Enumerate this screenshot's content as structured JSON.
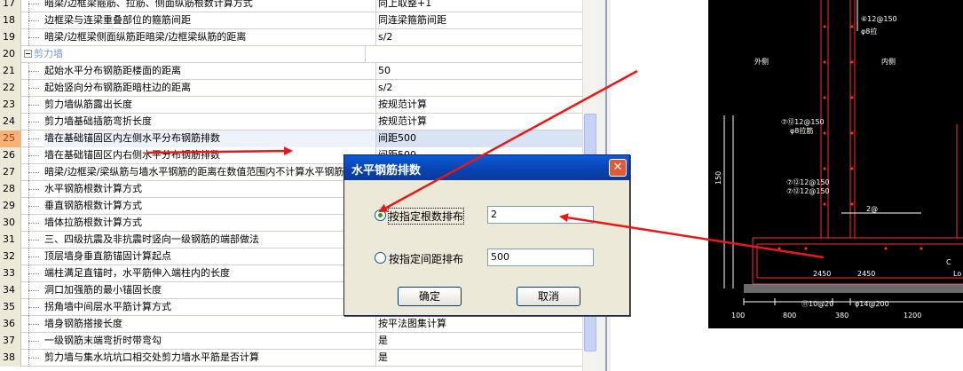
{
  "table": {
    "rows": [
      {
        "num": "17",
        "name": "暗梁/边框梁箍筋、拉筋、侧面纵筋根数计算方式",
        "value": "向上取整+1"
      },
      {
        "num": "18",
        "name": "边框梁与连梁重叠部位的箍筋间距",
        "value": "同连梁箍筋间距"
      },
      {
        "num": "19",
        "name": "暗梁/边框梁侧面纵筋距暗梁/边框梁纵筋的距离",
        "value": "s/2"
      },
      {
        "num": "20",
        "name": "剪力墙",
        "value": "",
        "category": true
      },
      {
        "num": "21",
        "name": "起始水平分布钢筋距楼面的距离",
        "value": "50"
      },
      {
        "num": "22",
        "name": "起始竖向分布钢筋距暗柱边的距离",
        "value": "s/2"
      },
      {
        "num": "23",
        "name": "剪力墙纵筋露出长度",
        "value": "按规范计算"
      },
      {
        "num": "24",
        "name": "剪力墙基础插筋弯折长度",
        "value": "按规范计算"
      },
      {
        "num": "25",
        "name": "墙在基础锚固区内左侧水平分布钢筋排数",
        "value": "间距500",
        "selected": true
      },
      {
        "num": "26",
        "name": "墙在基础锚固区内右侧水平分布钢筋排数",
        "value": "间距500"
      },
      {
        "num": "27",
        "name": "暗梁/边框梁/梁纵筋与墙水平钢筋的距离在数值范围内不计算水平钢筋",
        "value": ""
      },
      {
        "num": "28",
        "name": "水平钢筋根数计算方式",
        "value": ""
      },
      {
        "num": "29",
        "name": "垂直钢筋根数计算方式",
        "value": ""
      },
      {
        "num": "30",
        "name": "墙体拉筋根数计算方式",
        "value": ""
      },
      {
        "num": "31",
        "name": "三、四级抗震及非抗震时竖向一级钢筋的端部做法",
        "value": ""
      },
      {
        "num": "32",
        "name": "顶层墙身垂直筋锚固计算起点",
        "value": ""
      },
      {
        "num": "33",
        "name": "端柱满足直锚时，水平筋伸入端柱内的长度",
        "value": ""
      },
      {
        "num": "34",
        "name": "洞口加强筋的最小锚固长度",
        "value": ""
      },
      {
        "num": "35",
        "name": "拐角墙中间层水平筋计算方式",
        "value": ""
      },
      {
        "num": "36",
        "name": "墙身钢筋搭接长度",
        "value": "按平法图集计算"
      },
      {
        "num": "37",
        "name": "一级钢筋末端弯折时带弯勾",
        "value": "是"
      },
      {
        "num": "38",
        "name": "剪力墙与集水坑坑口相交处剪力墙水平筋是否计算",
        "value": "是"
      }
    ]
  },
  "dialog": {
    "title": "水平钢筋排数",
    "close_glyph": "✕",
    "option1_label": "按指定根数排布",
    "option1_value": "2",
    "option2_label": "按指定间距排布",
    "option2_value": "500",
    "ok_label": "确定",
    "cancel_label": "取消"
  },
  "cad": {
    "labels": {
      "outer_wall": "外侧",
      "label_top": "⑥12@150",
      "label_top2": "φ8拉",
      "inner_wall": "内侧",
      "rebar_a": "⑦⑫12@150",
      "rebar_a2": "φ8拉筋",
      "rebar_b": "⑦⑫12@150",
      "rebar_b2": "⑦⑫12@150",
      "side_dim": "150",
      "base_a": "2450",
      "base_b": "2450",
      "base_c": "Lo",
      "dim_1": "100",
      "dim_2": "800",
      "dim_3": "380",
      "dim_4": "1200",
      "bottom_a": "⑪10@20",
      "bottom_b": "φ14@200",
      "mark_2": "2@",
      "mark_c": "C"
    }
  }
}
